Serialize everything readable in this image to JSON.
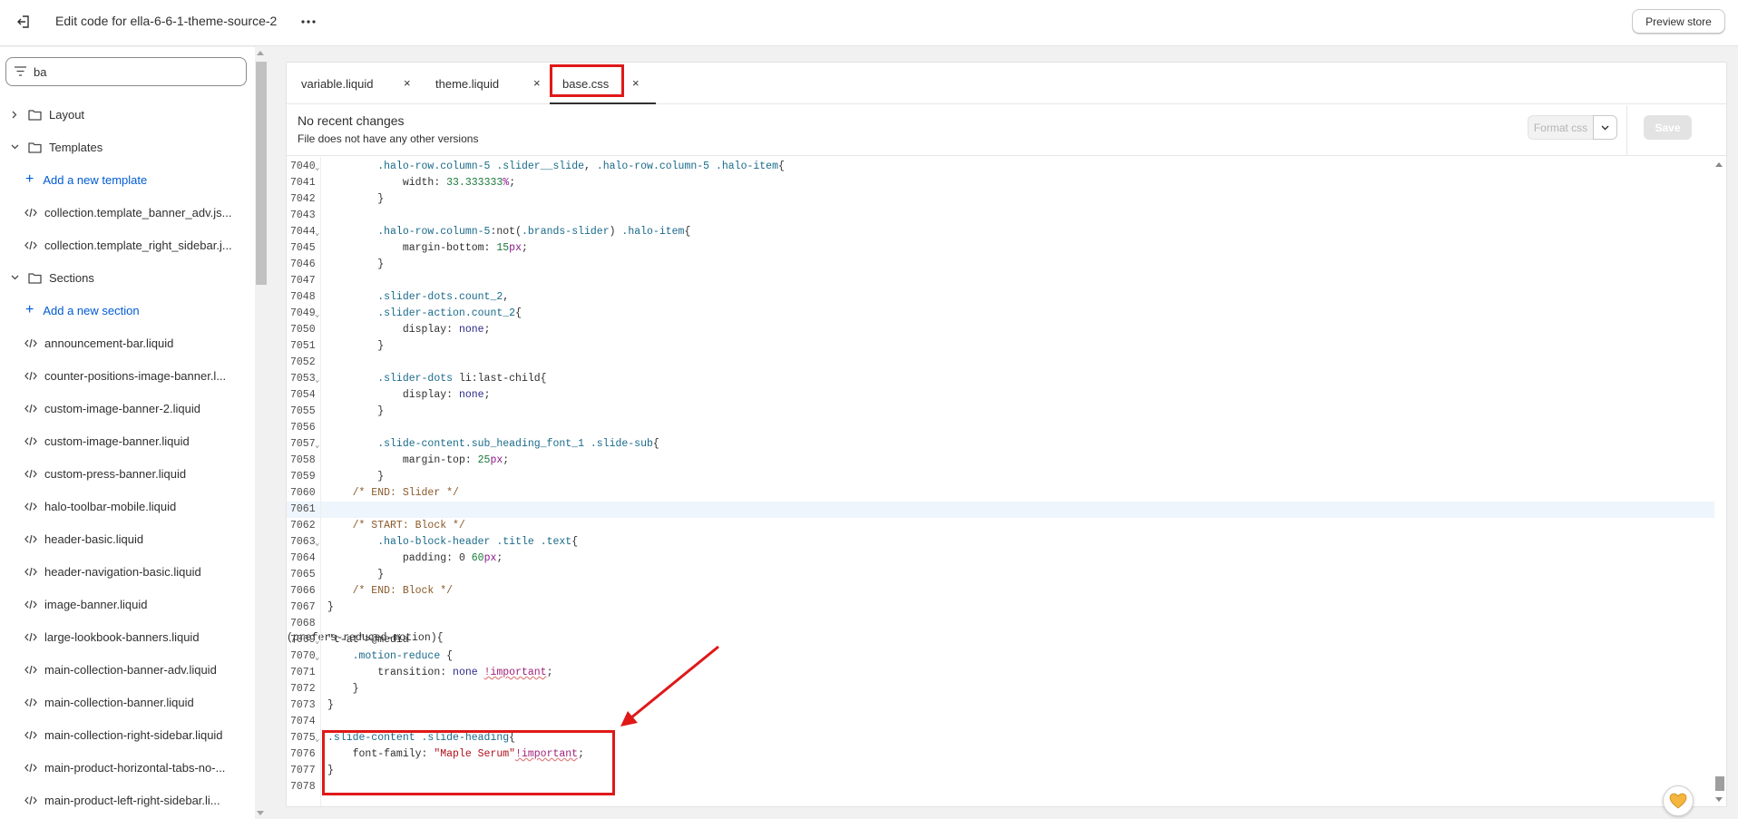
{
  "topbar": {
    "title": "Edit code for ella-6-6-1-theme-source-2",
    "preview_label": "Preview store"
  },
  "sidebar": {
    "search_value": "ba",
    "tree": [
      {
        "kind": "folder",
        "label": "Layout",
        "expanded": false
      },
      {
        "kind": "folder",
        "label": "Templates",
        "expanded": true
      },
      {
        "kind": "add",
        "label": "Add a new template"
      },
      {
        "kind": "file",
        "label": "collection.template_banner_adv.js..."
      },
      {
        "kind": "file",
        "label": "collection.template_right_sidebar.j..."
      },
      {
        "kind": "folder",
        "label": "Sections",
        "expanded": true
      },
      {
        "kind": "add",
        "label": "Add a new section"
      },
      {
        "kind": "file",
        "label": "announcement-bar.liquid"
      },
      {
        "kind": "file",
        "label": "counter-positions-image-banner.l..."
      },
      {
        "kind": "file",
        "label": "custom-image-banner-2.liquid"
      },
      {
        "kind": "file",
        "label": "custom-image-banner.liquid"
      },
      {
        "kind": "file",
        "label": "custom-press-banner.liquid"
      },
      {
        "kind": "file",
        "label": "halo-toolbar-mobile.liquid"
      },
      {
        "kind": "file",
        "label": "header-basic.liquid"
      },
      {
        "kind": "file",
        "label": "header-navigation-basic.liquid"
      },
      {
        "kind": "file",
        "label": "image-banner.liquid"
      },
      {
        "kind": "file",
        "label": "large-lookbook-banners.liquid"
      },
      {
        "kind": "file",
        "label": "main-collection-banner-adv.liquid"
      },
      {
        "kind": "file",
        "label": "main-collection-banner.liquid"
      },
      {
        "kind": "file",
        "label": "main-collection-right-sidebar.liquid"
      },
      {
        "kind": "file",
        "label": "main-product-horizontal-tabs-no-..."
      },
      {
        "kind": "file",
        "label": "main-product-left-right-sidebar.li..."
      }
    ]
  },
  "tabs": [
    {
      "label": "variable.liquid",
      "close": "×",
      "active": false
    },
    {
      "label": "theme.liquid",
      "close": "×",
      "active": false
    },
    {
      "label": "base.css",
      "close": "×",
      "active": true
    }
  ],
  "status": {
    "title": "No recent changes",
    "subtitle": "File does not have any other versions",
    "format_label": "Format css",
    "save_label": "Save"
  },
  "code": {
    "current_line": 7061,
    "lines": [
      {
        "n": "7040",
        "fold": true,
        "text": "        .halo-row.column-5 .slider__slide, .halo-row.column-5 .halo-item{"
      },
      {
        "n": "7041",
        "fold": false,
        "text": "            width: 33.333333%;"
      },
      {
        "n": "7042",
        "fold": false,
        "text": "        }"
      },
      {
        "n": "7043",
        "fold": false,
        "text": ""
      },
      {
        "n": "7044",
        "fold": true,
        "text": "        .halo-row.column-5:not(.brands-slider) .halo-item{"
      },
      {
        "n": "7045",
        "fold": false,
        "text": "            margin-bottom: 15px;"
      },
      {
        "n": "7046",
        "fold": false,
        "text": "        }"
      },
      {
        "n": "7047",
        "fold": false,
        "text": ""
      },
      {
        "n": "7048",
        "fold": false,
        "text": "        .slider-dots.count_2,"
      },
      {
        "n": "7049",
        "fold": true,
        "text": "        .slider-action.count_2{"
      },
      {
        "n": "7050",
        "fold": false,
        "text": "            display: none;"
      },
      {
        "n": "7051",
        "fold": false,
        "text": "        }"
      },
      {
        "n": "7052",
        "fold": false,
        "text": ""
      },
      {
        "n": "7053",
        "fold": true,
        "text": "        .slider-dots li:last-child{"
      },
      {
        "n": "7054",
        "fold": false,
        "text": "            display: none;"
      },
      {
        "n": "7055",
        "fold": false,
        "text": "        }"
      },
      {
        "n": "7056",
        "fold": false,
        "text": ""
      },
      {
        "n": "7057",
        "fold": true,
        "text": "        .slide-content.sub_heading_font_1 .slide-sub{"
      },
      {
        "n": "7058",
        "fold": false,
        "text": "            margin-top: 25px;"
      },
      {
        "n": "7059",
        "fold": false,
        "text": "        }"
      },
      {
        "n": "7060",
        "fold": false,
        "text": "    /* END: Slider */"
      },
      {
        "n": "7061",
        "fold": false,
        "text": ""
      },
      {
        "n": "7062",
        "fold": false,
        "text": "    /* START: Block */"
      },
      {
        "n": "7063",
        "fold": true,
        "text": "        .halo-block-header .title .text{"
      },
      {
        "n": "7064",
        "fold": false,
        "text": "            padding: 0 60px;"
      },
      {
        "n": "7065",
        "fold": false,
        "text": "        }"
      },
      {
        "n": "7066",
        "fold": false,
        "text": "    /* END: Block */"
      },
      {
        "n": "7067",
        "fold": false,
        "text": "}"
      },
      {
        "n": "7068",
        "fold": false,
        "text": ""
      },
      {
        "n": "7069",
        "fold": true,
        "text": "@media (prefers-reduced-motion){"
      },
      {
        "n": "7070",
        "fold": true,
        "text": "    .motion-reduce {"
      },
      {
        "n": "7071",
        "fold": false,
        "text": "        transition: none !important;"
      },
      {
        "n": "7072",
        "fold": false,
        "text": "    }"
      },
      {
        "n": "7073",
        "fold": false,
        "text": "}"
      },
      {
        "n": "7074",
        "fold": false,
        "text": ""
      },
      {
        "n": "7075",
        "fold": true,
        "text": ".slide-content .slide-heading{"
      },
      {
        "n": "7076",
        "fold": false,
        "text": "    font-family: \"Maple Serum\"!important;"
      },
      {
        "n": "7077",
        "fold": false,
        "text": "}"
      },
      {
        "n": "7078",
        "fold": false,
        "text": ""
      }
    ]
  },
  "colors": {
    "accent_link": "#005bd3",
    "annotation_red": "#e01818",
    "current_line_bg": "#eef5fc"
  },
  "icons": {
    "back": "exit-icon",
    "more": "ellipsis-icon",
    "filter": "filter-icon",
    "folder": "folder-icon",
    "code": "code-icon",
    "help": "help-heart-icon"
  }
}
